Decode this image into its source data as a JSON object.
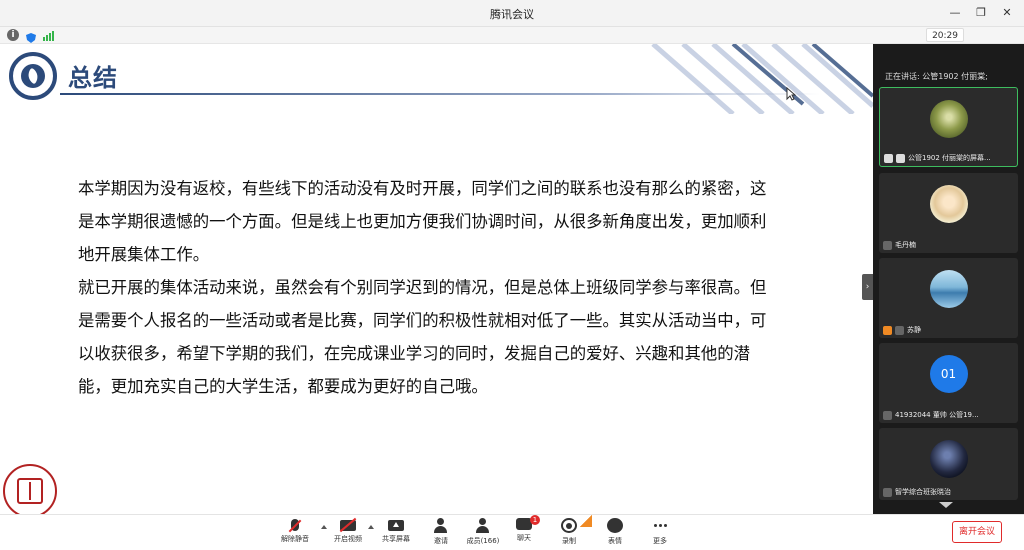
{
  "window": {
    "title": "腾讯会议"
  },
  "infobar": {
    "time": "20:29"
  },
  "slide": {
    "title": "总结",
    "paragraphs": [
      "本学期因为没有返校，有些线下的活动没有及时开展，同学们之间的联系也没有那么的紧密，这是本学期很遗憾的一个方面。但是线上也更加方便我们协调时间，从很多新角度出发，更加顺利地开展集体工作。",
      "就已开展的集体活动来说，虽然会有个别同学迟到的情况，但是总体上班级同学参与率很高。但是需要个人报名的一些活动或者是比赛，同学们的积极性就相对低了一些。其实从活动当中，可以收获很多，希望下学期的我们，在完成课业学习的同时，发掘自己的爱好、兴趣和其他的潜能，更加充实自己的大学生活，都要成为更好的自己哦。"
    ]
  },
  "panel": {
    "speaker": "正在讲话: 公管1902 付丽棠;",
    "participants": [
      {
        "name": "公管1902 付丽棠的屏幕...",
        "avatar": "photo"
      },
      {
        "name": "毛丹楠",
        "avatar": "photo"
      },
      {
        "name": "苏静",
        "avatar": "photo"
      },
      {
        "name": "41932044 董帅 公管19...",
        "avatar": "01"
      },
      {
        "name": "智学综合班张晓治",
        "avatar": "photo"
      }
    ]
  },
  "toolbar": {
    "unmute": "解除静音",
    "start_video": "开启视频",
    "share_screen": "共享屏幕",
    "invite": "邀请",
    "members": "成员(166)",
    "chat": "聊天",
    "chat_badge": "1",
    "record": "录制",
    "emoji": "表情",
    "more": "更多",
    "leave": "离开会议"
  },
  "colors": {
    "accent": "#2c4a7a",
    "danger": "#e02b2b",
    "active_border": "#3ebd5f",
    "panel_bg": "#1b1b1b"
  }
}
